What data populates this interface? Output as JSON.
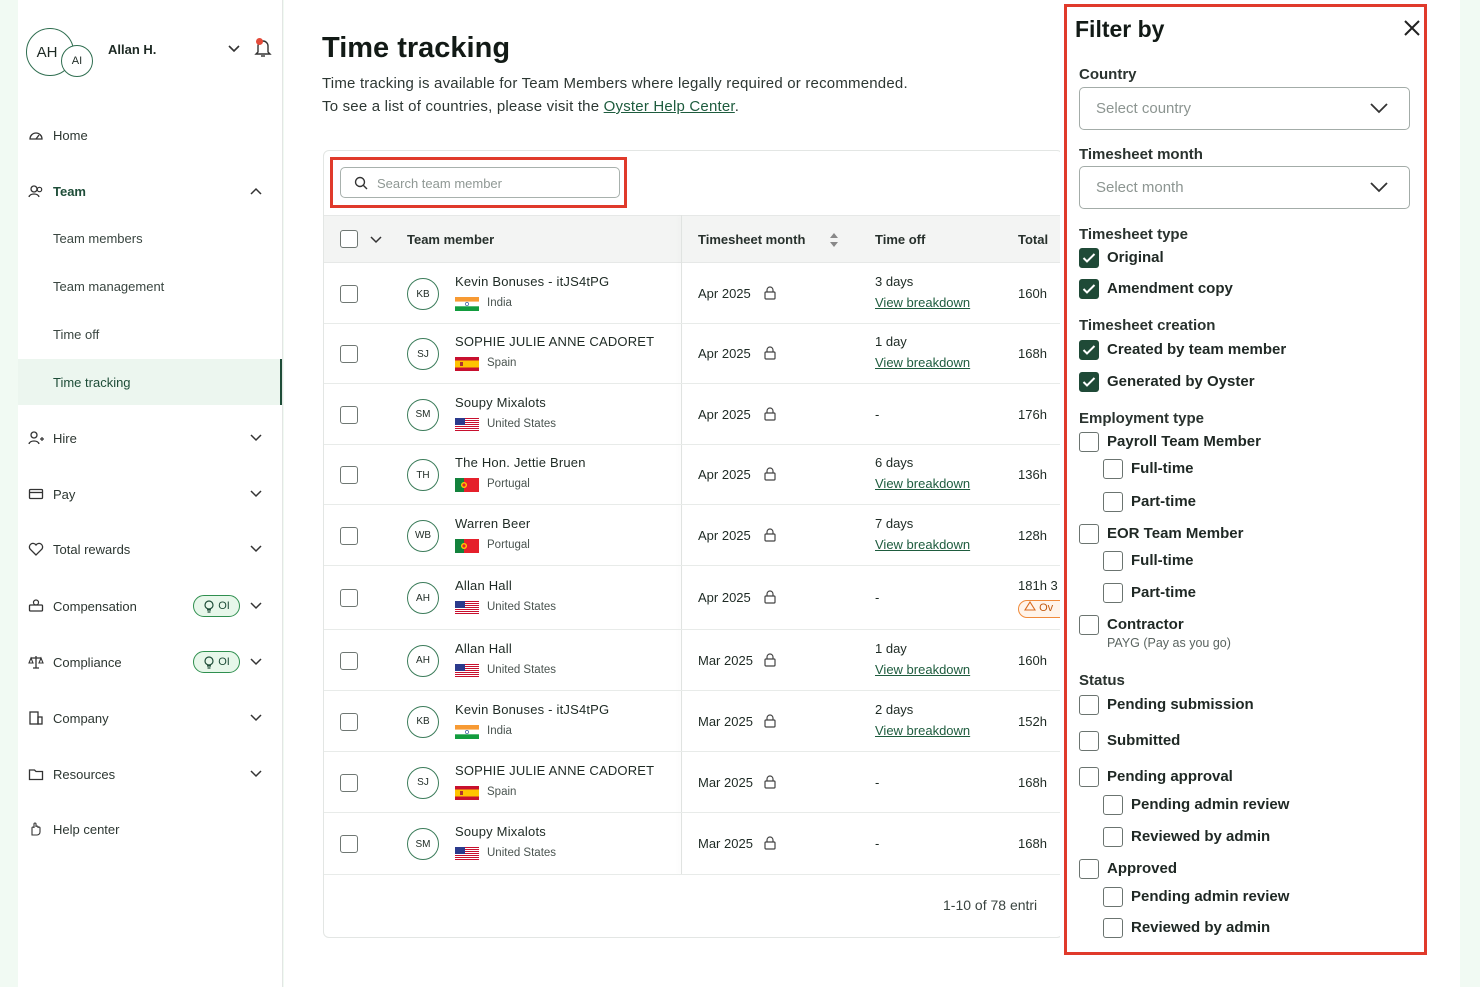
{
  "user": {
    "initials": "AH",
    "org_initials": "AI",
    "name": "Allan H."
  },
  "sidebar": {
    "items": [
      {
        "label": "Home"
      },
      {
        "label": "Team"
      },
      {
        "label": "Team members"
      },
      {
        "label": "Team management"
      },
      {
        "label": "Time off"
      },
      {
        "label": "Time tracking"
      },
      {
        "label": "Hire"
      },
      {
        "label": "Pay"
      },
      {
        "label": "Total rewards"
      },
      {
        "label": "Compensation",
        "badge": "OI"
      },
      {
        "label": "Compliance",
        "badge": "OI"
      },
      {
        "label": "Company"
      },
      {
        "label": "Resources"
      },
      {
        "label": "Help center"
      }
    ]
  },
  "page": {
    "title": "Time tracking",
    "desc_line1": "Time tracking is available for Team Members where legally required or recommended.",
    "desc_line2_prefix": "To see a list of countries, please visit the ",
    "desc_link": "Oyster Help Center",
    "desc_line2_suffix": "."
  },
  "search": {
    "placeholder": "Search team member"
  },
  "table": {
    "columns": {
      "member": "Team member",
      "month": "Timesheet month",
      "timeoff": "Time off",
      "total": "Total"
    },
    "rows": [
      {
        "initials": "KB",
        "name": "Kevin Bonuses - itJS4tPG",
        "country": "India",
        "flag": "in",
        "month": "Apr 2025",
        "timeoff": "3 days",
        "link": "View breakdown",
        "total": "160h"
      },
      {
        "initials": "SJ",
        "name": "SOPHIE JULIE ANNE CADORET",
        "country": "Spain",
        "flag": "es",
        "month": "Apr 2025",
        "timeoff": "1 day",
        "link": "View breakdown",
        "total": "168h"
      },
      {
        "initials": "SM",
        "name": "Soupy Mixalots",
        "country": "United States",
        "flag": "us",
        "month": "Apr 2025",
        "timeoff": "-",
        "link": "",
        "total": "176h"
      },
      {
        "initials": "TH",
        "name": "The Hon. Jettie Bruen",
        "country": "Portugal",
        "flag": "pt",
        "month": "Apr 2025",
        "timeoff": "6 days",
        "link": "View breakdown",
        "total": "136h"
      },
      {
        "initials": "WB",
        "name": "Warren Beer",
        "country": "Portugal",
        "flag": "pt",
        "month": "Apr 2025",
        "timeoff": "7 days",
        "link": "View breakdown",
        "total": "128h"
      },
      {
        "initials": "AH",
        "name": "Allan Hall",
        "country": "United States",
        "flag": "us",
        "month": "Apr 2025",
        "timeoff": "-",
        "link": "",
        "total": "181h 3",
        "warning": "Ov"
      },
      {
        "initials": "AH",
        "name": "Allan Hall",
        "country": "United States",
        "flag": "us",
        "month": "Mar 2025",
        "timeoff": "1 day",
        "link": "View breakdown",
        "total": "160h"
      },
      {
        "initials": "KB",
        "name": "Kevin Bonuses - itJS4tPG",
        "country": "India",
        "flag": "in",
        "month": "Mar 2025",
        "timeoff": "2 days",
        "link": "View breakdown",
        "total": "152h"
      },
      {
        "initials": "SJ",
        "name": "SOPHIE JULIE ANNE CADORET",
        "country": "Spain",
        "flag": "es",
        "month": "Mar 2025",
        "timeoff": "-",
        "link": "",
        "total": "168h"
      },
      {
        "initials": "SM",
        "name": "Soupy Mixalots",
        "country": "United States",
        "flag": "us",
        "month": "Mar 2025",
        "timeoff": "-",
        "link": "",
        "total": "168h"
      }
    ],
    "pagination": "1-10 of 78 entri"
  },
  "filter": {
    "title": "Filter by",
    "country_label": "Country",
    "country_placeholder": "Select country",
    "month_label": "Timesheet month",
    "month_placeholder": "Select month",
    "type_label": "Timesheet type",
    "creation_label": "Timesheet creation",
    "employment_label": "Employment type",
    "status_label": "Status",
    "options": [
      {
        "label": "Original",
        "checked": true
      },
      {
        "label": "Amendment copy",
        "checked": true
      },
      {
        "label": "Created by team member",
        "checked": true
      },
      {
        "label": "Generated by Oyster",
        "checked": true
      },
      {
        "label": "Payroll Team Member",
        "checked": false
      },
      {
        "label": "Full-time",
        "checked": false
      },
      {
        "label": "Part-time",
        "checked": false
      },
      {
        "label": "EOR Team Member",
        "checked": false
      },
      {
        "label": "Full-time",
        "checked": false
      },
      {
        "label": "Part-time",
        "checked": false
      },
      {
        "label": "Contractor",
        "sub": "PAYG (Pay as you go)",
        "checked": false
      },
      {
        "label": "Pending submission",
        "checked": false
      },
      {
        "label": "Submitted",
        "checked": false
      },
      {
        "label": "Pending approval",
        "checked": false
      },
      {
        "label": "Pending admin review",
        "checked": false
      },
      {
        "label": "Reviewed by admin",
        "checked": false
      },
      {
        "label": "Approved",
        "checked": false
      },
      {
        "label": "Pending admin review",
        "checked": false
      },
      {
        "label": "Reviewed by admin",
        "checked": false
      }
    ]
  },
  "colors": {
    "brand": "#1f4a37",
    "highlight": "#e03a2b",
    "link": "#1e5c3e"
  }
}
